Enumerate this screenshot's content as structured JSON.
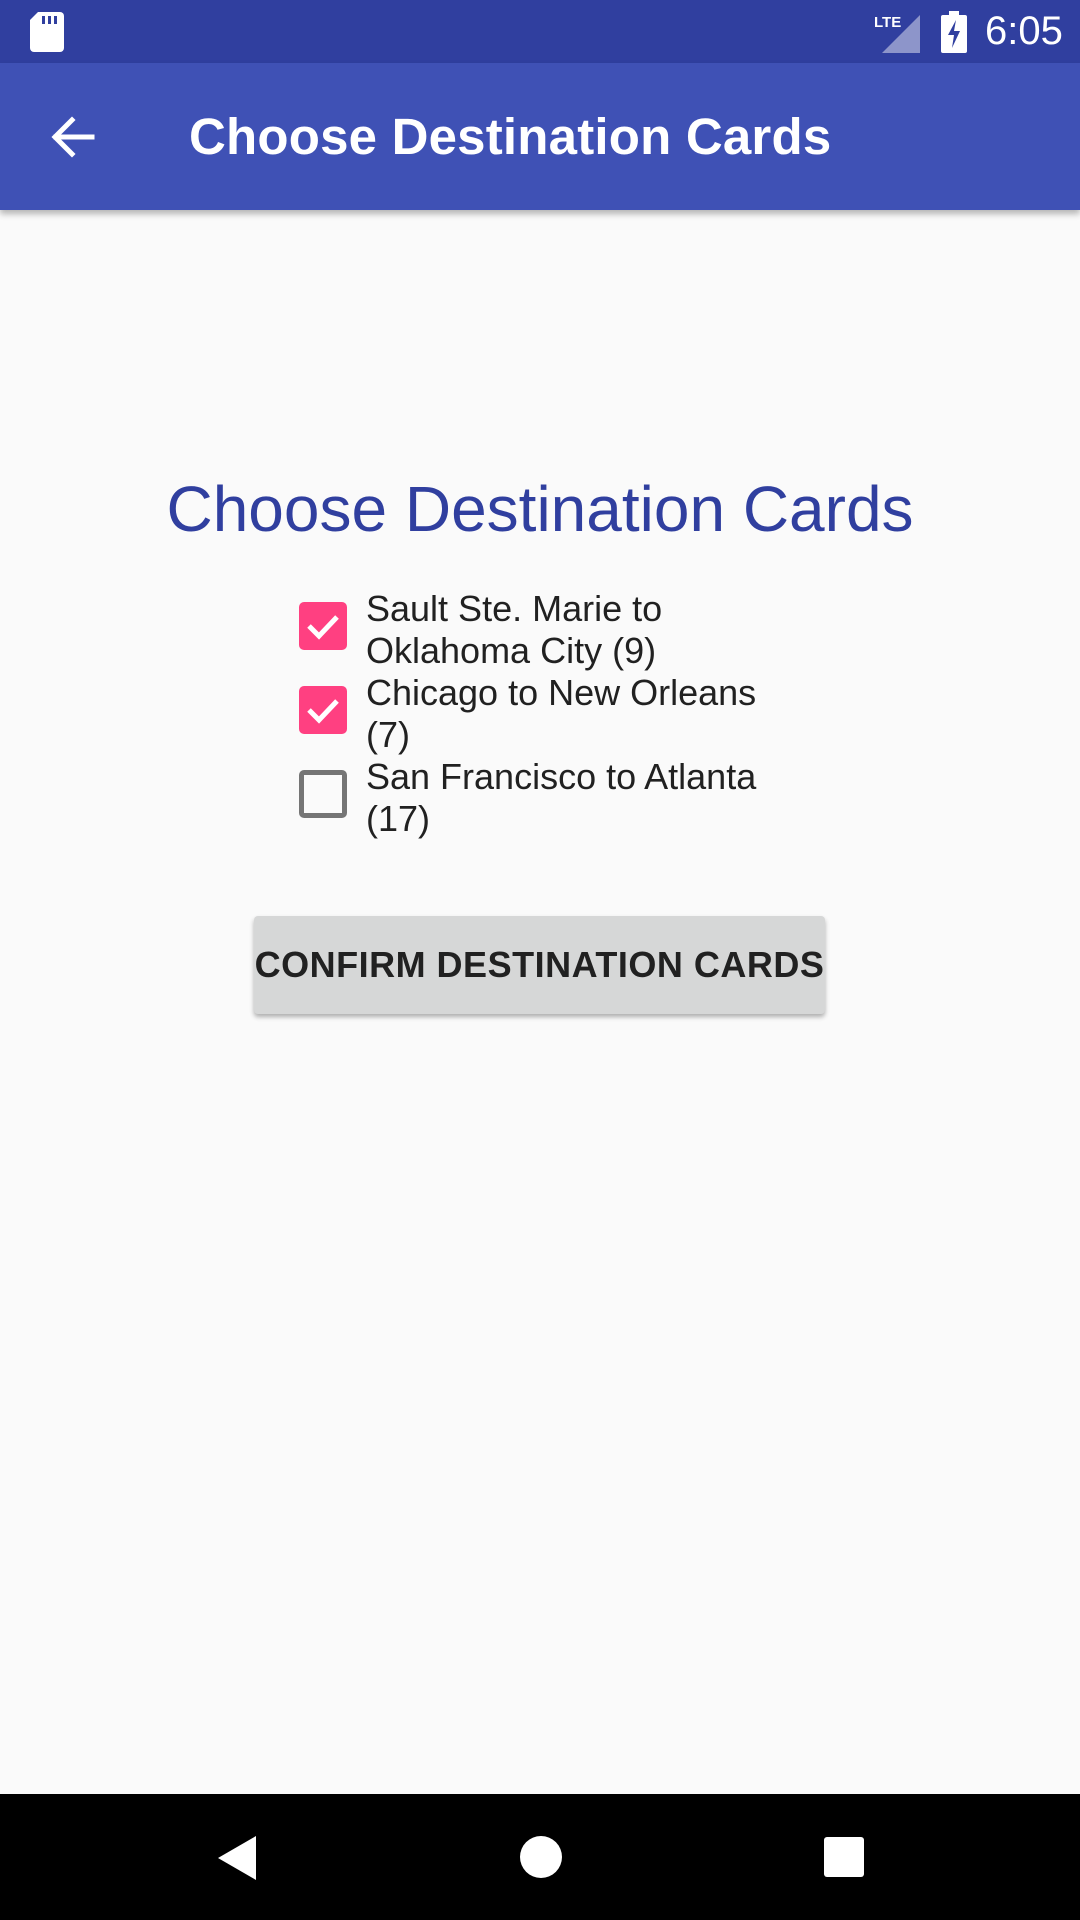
{
  "status_bar": {
    "time": "6:05",
    "network_label": "LTE",
    "icons": [
      "sd-card-icon",
      "lte-signal-icon",
      "battery-charging-icon"
    ]
  },
  "app_bar": {
    "title": "Choose Destination Cards",
    "back_icon": "arrow-back-icon"
  },
  "main": {
    "heading": "Choose Destination Cards",
    "cards": [
      {
        "label": "Sault Ste. Marie to Oklahoma City (9)",
        "checked": true
      },
      {
        "label": "Chicago to New Orleans (7)",
        "checked": true
      },
      {
        "label": "San Francisco to Atlanta (17)",
        "checked": false
      }
    ],
    "confirm_label": "CONFIRM DESTINATION CARDS"
  },
  "nav_bar": {
    "icons": [
      "back-triangle-icon",
      "home-circle-icon",
      "recents-square-icon"
    ]
  },
  "colors": {
    "status_bar": "#303f9f",
    "app_bar": "#3f51b5",
    "heading": "#303f9f",
    "checkbox_checked": "#ff4081",
    "background": "#fafafa"
  }
}
